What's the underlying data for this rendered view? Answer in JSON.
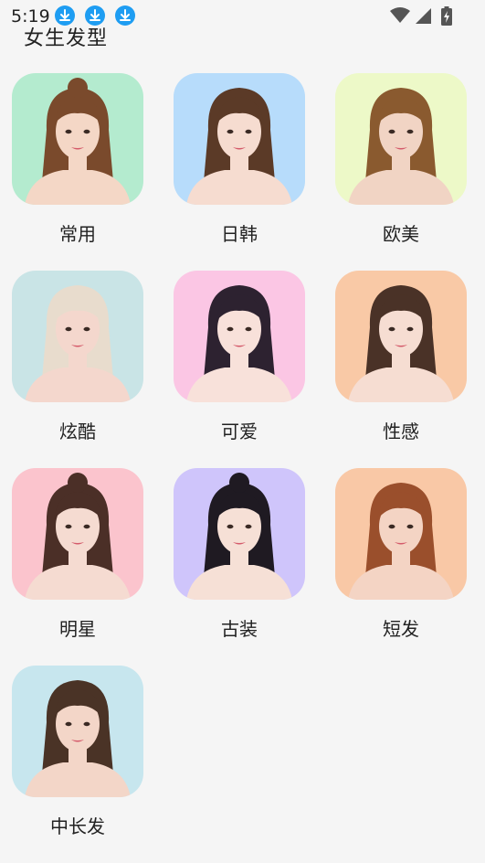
{
  "status_bar": {
    "time": "5:19",
    "notification_icons": [
      "download-icon",
      "download-icon",
      "download-icon"
    ],
    "system_icons": [
      "wifi-icon",
      "signal-icon",
      "battery-charging-icon"
    ]
  },
  "page": {
    "title": "女生发型"
  },
  "styles": [
    {
      "label": "常用",
      "bg": "#b4ebcf",
      "hair": "#7a4a2c",
      "skin": "#f4d7c6",
      "bun": true
    },
    {
      "label": "日韩",
      "bg": "#b7dcfb",
      "hair": "#5b3a27",
      "skin": "#f6dcd0",
      "bun": false
    },
    {
      "label": "欧美",
      "bg": "#edf9c8",
      "hair": "#8a5a2f",
      "skin": "#f1d4c4",
      "bun": false
    },
    {
      "label": "炫酷",
      "bg": "#c9e4e6",
      "hair": "#e8dccd",
      "skin": "#f4d7cd",
      "bun": false
    },
    {
      "label": "可爱",
      "bg": "#fbc6e4",
      "hair": "#2d2230",
      "skin": "#f8e1da",
      "bun": false
    },
    {
      "label": "性感",
      "bg": "#f9c9a6",
      "hair": "#4a3227",
      "skin": "#f6ddd2",
      "bun": false
    },
    {
      "label": "明星",
      "bg": "#fbc4cd",
      "hair": "#4b2f27",
      "skin": "#f5dbd1",
      "bun": true
    },
    {
      "label": "古装",
      "bg": "#cfc5fb",
      "hair": "#1f1a22",
      "skin": "#f6e0d6",
      "bun": true
    },
    {
      "label": "短发",
      "bg": "#f9c8a6",
      "hair": "#9a4f2c",
      "skin": "#f4d4c4",
      "bun": false
    },
    {
      "label": "中长发",
      "bg": "#c7e6ee",
      "hair": "#4a3326",
      "skin": "#f3d6c8",
      "bun": false
    }
  ]
}
